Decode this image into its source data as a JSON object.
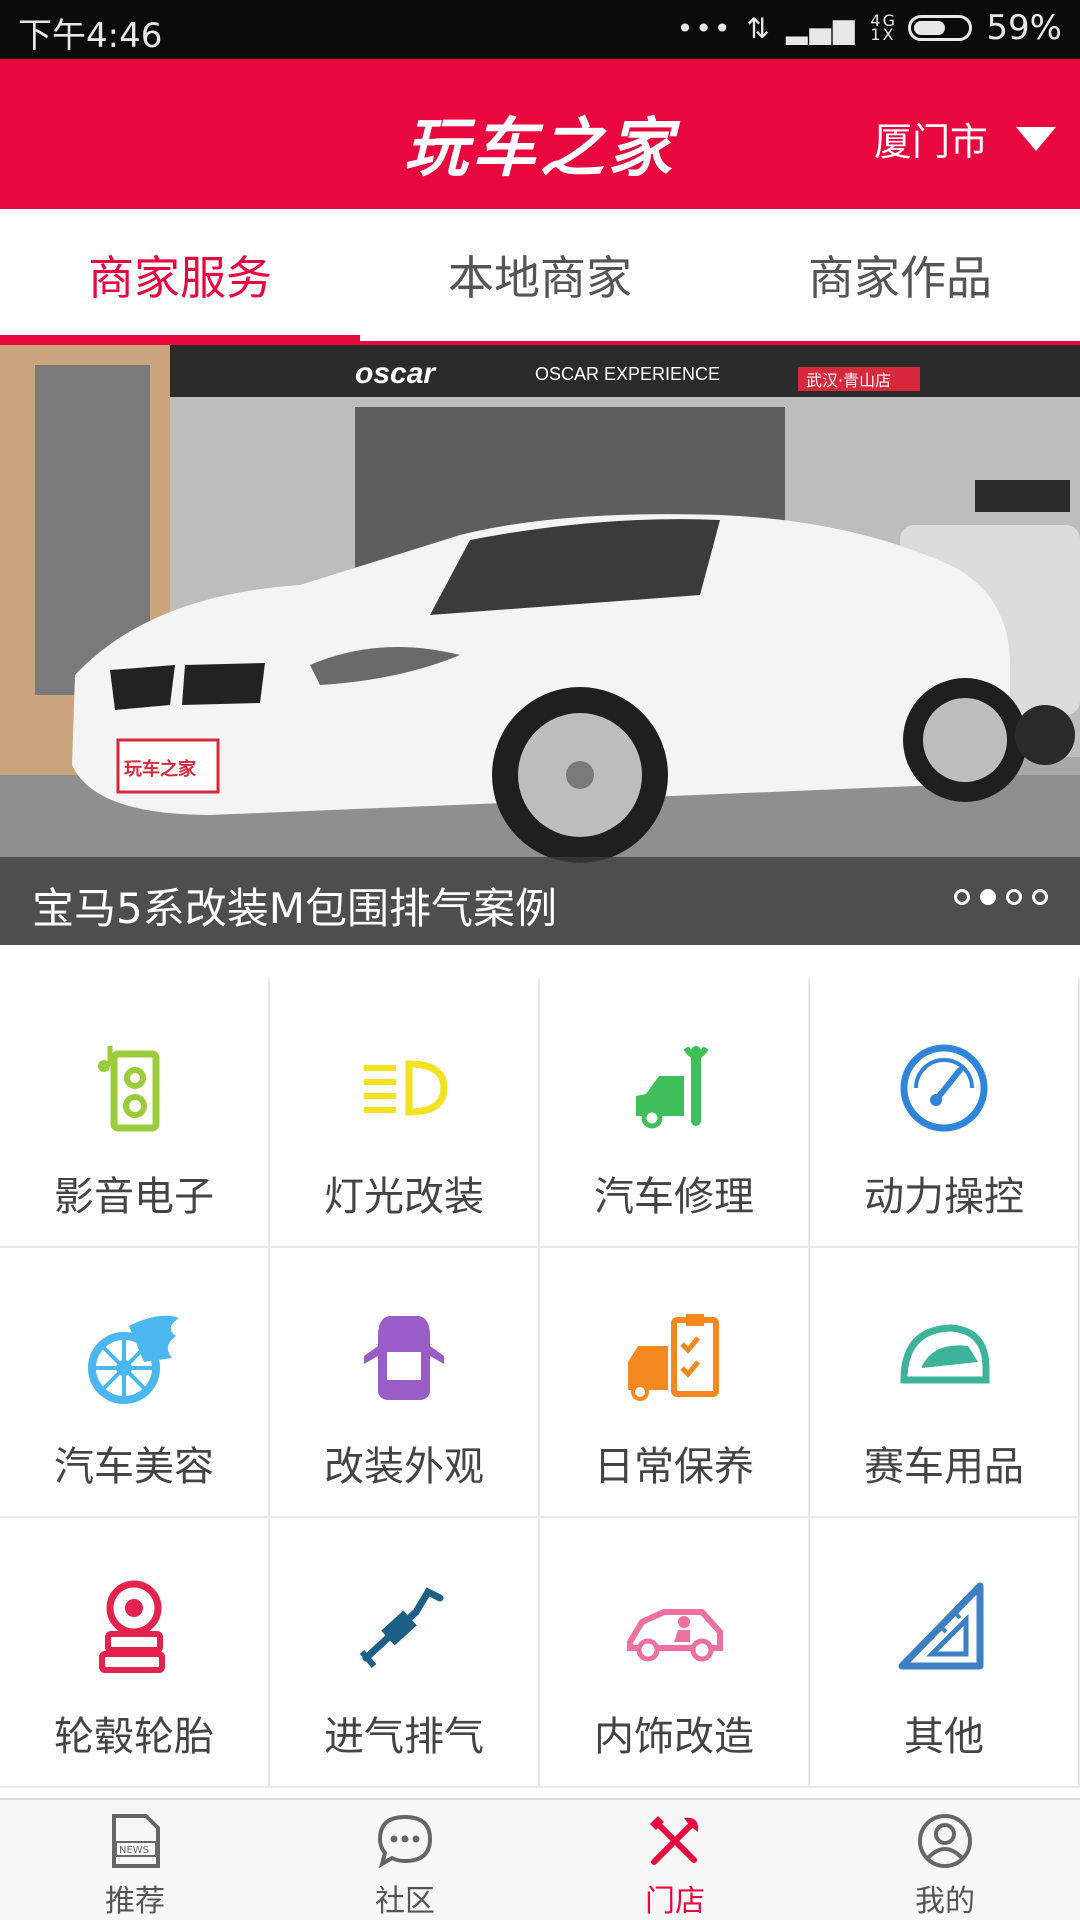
{
  "status_bar": {
    "time": "下午4:46",
    "battery": "59%",
    "battery_level": 0.59,
    "network": "4G 1X"
  },
  "header": {
    "title": "玩车之家",
    "city": "厦门市"
  },
  "tabs": [
    {
      "label": "商家服务",
      "active": true
    },
    {
      "label": "本地商家",
      "active": false
    },
    {
      "label": "商家作品",
      "active": false
    }
  ],
  "banner": {
    "caption": "宝马5系改装M包围排气案例",
    "storefront_sign": "oscar",
    "storefront_subsign": "OSCAR EXPERIENCE",
    "shop_badge": "武汉·青山店",
    "plate_text": "玩车之家",
    "slides_total": 4,
    "active_slide": 2
  },
  "categories": [
    {
      "label": "影音电子",
      "icon": "speaker-icon",
      "color": "#9ccc3c"
    },
    {
      "label": "灯光改装",
      "icon": "headlight-icon",
      "color": "#f2e21f"
    },
    {
      "label": "汽车修理",
      "icon": "car-wrench-icon",
      "color": "#3fbf5a"
    },
    {
      "label": "动力操控",
      "icon": "speedometer-icon",
      "color": "#2f86d9"
    },
    {
      "label": "汽车美容",
      "icon": "wheel-wash-icon",
      "color": "#4ab7f0"
    },
    {
      "label": "改装外观",
      "icon": "car-top-icon",
      "color": "#9a5cc7"
    },
    {
      "label": "日常保养",
      "icon": "maintenance-checklist-icon",
      "color": "#f5891f"
    },
    {
      "label": "赛车用品",
      "icon": "racing-helmet-icon",
      "color": "#3db39a"
    },
    {
      "label": "轮毂轮胎",
      "icon": "tire-icon",
      "color": "#e5224e"
    },
    {
      "label": "进气排气",
      "icon": "exhaust-pipe-icon",
      "color": "#1e5f86"
    },
    {
      "label": "内饰改造",
      "icon": "interior-icon",
      "color": "#ee6fa1"
    },
    {
      "label": "其他",
      "icon": "set-square-icon",
      "color": "#3d7fc3"
    }
  ],
  "bottom_nav": [
    {
      "label": "推荐",
      "icon": "news-icon",
      "badge": "NEWS",
      "active": false
    },
    {
      "label": "社区",
      "icon": "chat-bubble-icon",
      "active": false
    },
    {
      "label": "门店",
      "icon": "tools-icon",
      "active": true
    },
    {
      "label": "我的",
      "icon": "user-icon",
      "active": false
    }
  ],
  "colors": {
    "brand": "#e8073f",
    "text": "#444444",
    "grid_line": "#e9e9e9"
  }
}
